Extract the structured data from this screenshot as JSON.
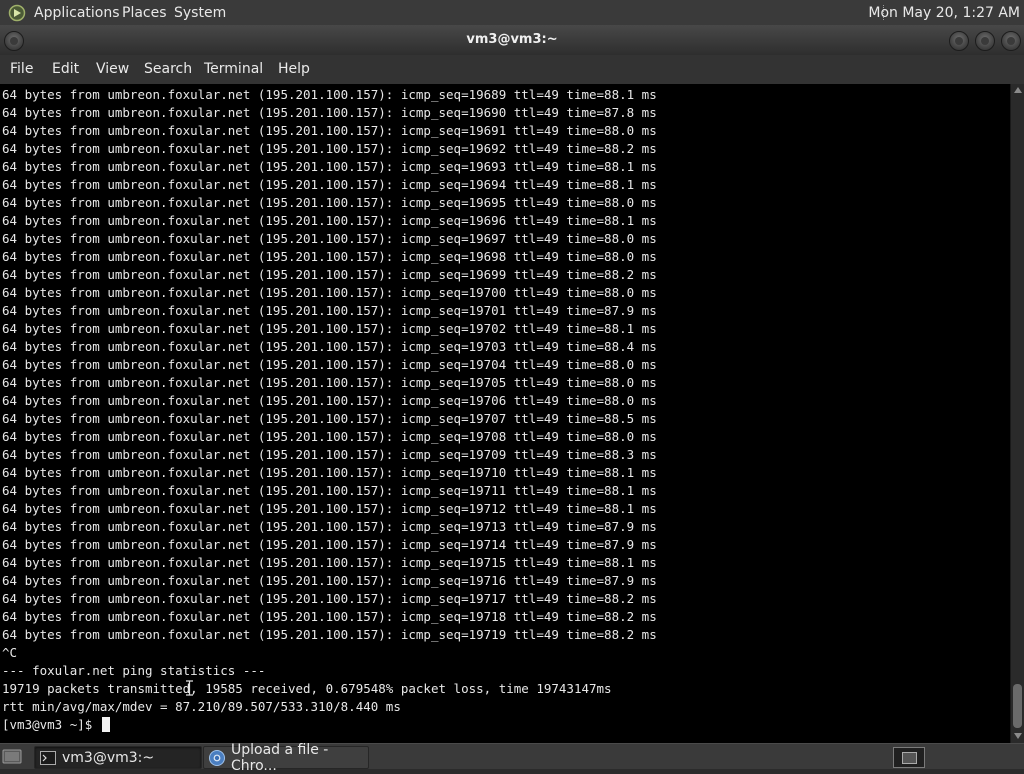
{
  "top_panel": {
    "applications": "Applications",
    "places": "Places",
    "system": "System",
    "clock": "Mon May 20,  1:27 AM"
  },
  "window": {
    "title": "vm3@vm3:~"
  },
  "menubar": {
    "file": "File",
    "edit": "Edit",
    "view": "View",
    "search": "Search",
    "terminal": "Terminal",
    "help": "Help"
  },
  "terminal": {
    "lines": [
      "64 bytes from umbreon.foxular.net (195.201.100.157): icmp_seq=19689 ttl=49 time=88.1 ms",
      "64 bytes from umbreon.foxular.net (195.201.100.157): icmp_seq=19690 ttl=49 time=87.8 ms",
      "64 bytes from umbreon.foxular.net (195.201.100.157): icmp_seq=19691 ttl=49 time=88.0 ms",
      "64 bytes from umbreon.foxular.net (195.201.100.157): icmp_seq=19692 ttl=49 time=88.2 ms",
      "64 bytes from umbreon.foxular.net (195.201.100.157): icmp_seq=19693 ttl=49 time=88.1 ms",
      "64 bytes from umbreon.foxular.net (195.201.100.157): icmp_seq=19694 ttl=49 time=88.1 ms",
      "64 bytes from umbreon.foxular.net (195.201.100.157): icmp_seq=19695 ttl=49 time=88.0 ms",
      "64 bytes from umbreon.foxular.net (195.201.100.157): icmp_seq=19696 ttl=49 time=88.1 ms",
      "64 bytes from umbreon.foxular.net (195.201.100.157): icmp_seq=19697 ttl=49 time=88.0 ms",
      "64 bytes from umbreon.foxular.net (195.201.100.157): icmp_seq=19698 ttl=49 time=88.0 ms",
      "64 bytes from umbreon.foxular.net (195.201.100.157): icmp_seq=19699 ttl=49 time=88.2 ms",
      "64 bytes from umbreon.foxular.net (195.201.100.157): icmp_seq=19700 ttl=49 time=88.0 ms",
      "64 bytes from umbreon.foxular.net (195.201.100.157): icmp_seq=19701 ttl=49 time=87.9 ms",
      "64 bytes from umbreon.foxular.net (195.201.100.157): icmp_seq=19702 ttl=49 time=88.1 ms",
      "64 bytes from umbreon.foxular.net (195.201.100.157): icmp_seq=19703 ttl=49 time=88.4 ms",
      "64 bytes from umbreon.foxular.net (195.201.100.157): icmp_seq=19704 ttl=49 time=88.0 ms",
      "64 bytes from umbreon.foxular.net (195.201.100.157): icmp_seq=19705 ttl=49 time=88.0 ms",
      "64 bytes from umbreon.foxular.net (195.201.100.157): icmp_seq=19706 ttl=49 time=88.0 ms",
      "64 bytes from umbreon.foxular.net (195.201.100.157): icmp_seq=19707 ttl=49 time=88.5 ms",
      "64 bytes from umbreon.foxular.net (195.201.100.157): icmp_seq=19708 ttl=49 time=88.0 ms",
      "64 bytes from umbreon.foxular.net (195.201.100.157): icmp_seq=19709 ttl=49 time=88.3 ms",
      "64 bytes from umbreon.foxular.net (195.201.100.157): icmp_seq=19710 ttl=49 time=88.1 ms",
      "64 bytes from umbreon.foxular.net (195.201.100.157): icmp_seq=19711 ttl=49 time=88.1 ms",
      "64 bytes from umbreon.foxular.net (195.201.100.157): icmp_seq=19712 ttl=49 time=88.1 ms",
      "64 bytes from umbreon.foxular.net (195.201.100.157): icmp_seq=19713 ttl=49 time=87.9 ms",
      "64 bytes from umbreon.foxular.net (195.201.100.157): icmp_seq=19714 ttl=49 time=87.9 ms",
      "64 bytes from umbreon.foxular.net (195.201.100.157): icmp_seq=19715 ttl=49 time=88.1 ms",
      "64 bytes from umbreon.foxular.net (195.201.100.157): icmp_seq=19716 ttl=49 time=87.9 ms",
      "64 bytes from umbreon.foxular.net (195.201.100.157): icmp_seq=19717 ttl=49 time=88.2 ms",
      "64 bytes from umbreon.foxular.net (195.201.100.157): icmp_seq=19718 ttl=49 time=88.2 ms",
      "64 bytes from umbreon.foxular.net (195.201.100.157): icmp_seq=19719 ttl=49 time=88.2 ms",
      "^C",
      "--- foxular.net ping statistics ---",
      "19719 packets transmitted, 19585 received, 0.679548% packet loss, time 19743147ms",
      "rtt min/avg/max/mdev = 87.210/89.507/533.310/8.440 ms"
    ],
    "prompt": "[vm3@vm3 ~]$ "
  },
  "taskbar": {
    "tasks": [
      {
        "label": "vm3@vm3:~"
      },
      {
        "label": "Upload a file - Chro..."
      }
    ]
  }
}
